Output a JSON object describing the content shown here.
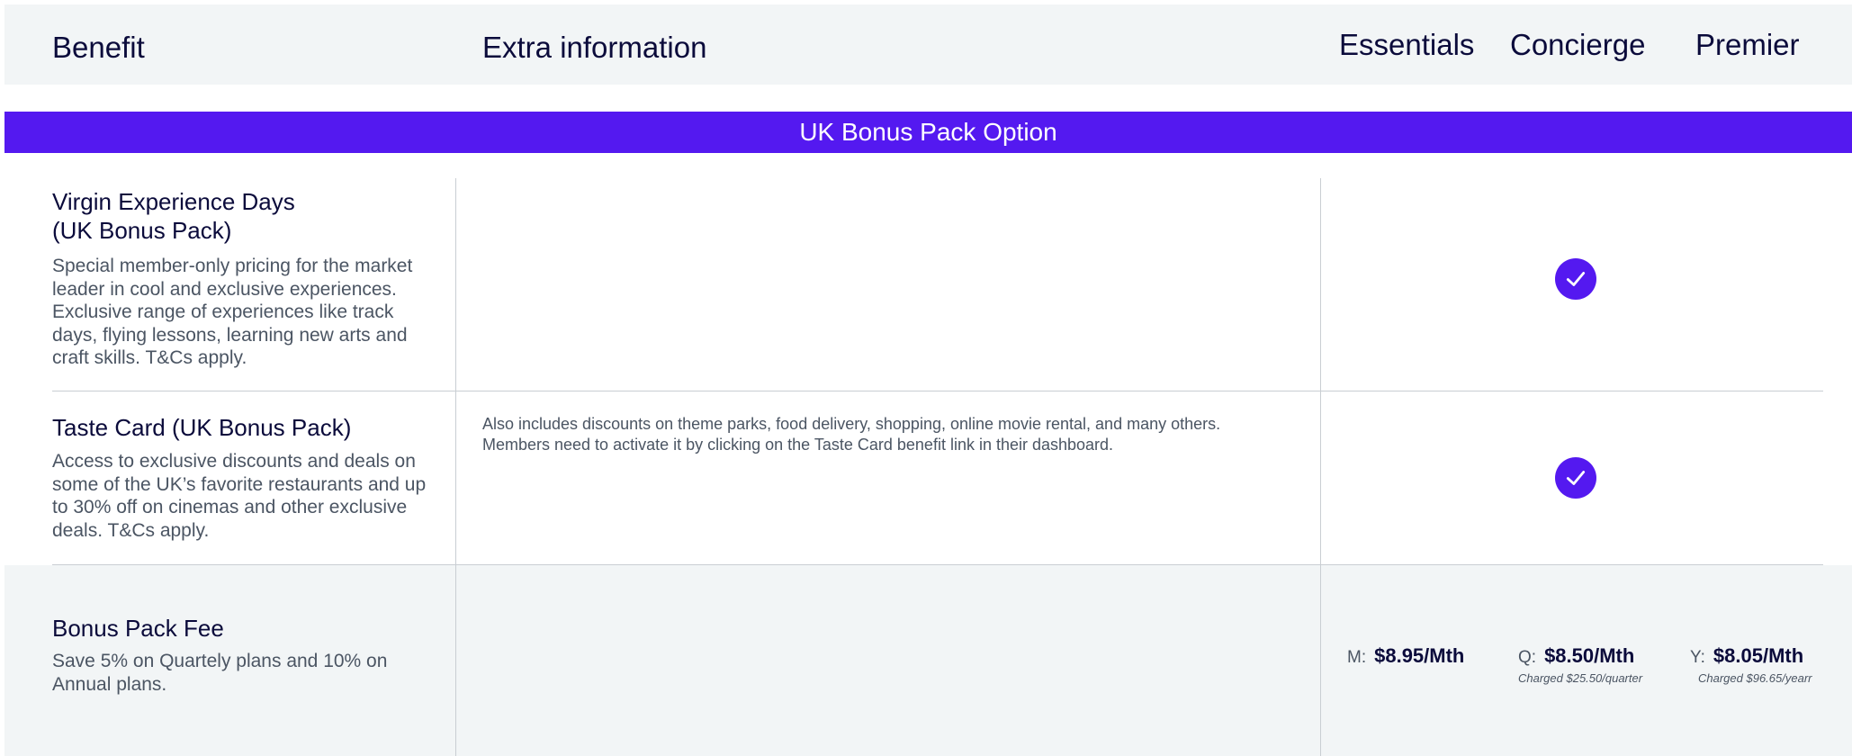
{
  "header": {
    "benefit": "Benefit",
    "extra": "Extra information",
    "essentials": "Essentials",
    "concierge": "Concierge",
    "premier": "Premier"
  },
  "section": {
    "title": "UK Bonus Pack Option"
  },
  "rows": [
    {
      "title_line1": "Virgin Experience Days",
      "title_line2": "(UK Bonus Pack)",
      "desc_lines": [
        "Special member-only pricing for the market",
        "leader in cool and exclusive experiences.",
        "Exclusive range of experiences like track",
        "days, flying lessons, learning new arts and",
        "craft skills. T&Cs apply."
      ],
      "included": {
        "essentials": false,
        "concierge": true,
        "premier": false
      }
    },
    {
      "title_line1": "Taste Card (UK Bonus Pack)",
      "desc_lines": [
        "Access to exclusive discounts and deals on",
        "some of the UK’s favorite restaurants and up",
        "to 30% off on cinemas and other exclusive",
        "deals. T&Cs apply."
      ],
      "extra_lines": [
        "Also includes discounts on theme parks, food delivery, shopping, online movie rental, and many others.",
        "Members need to activate it by clicking on the Taste Card benefit link in their dashboard."
      ],
      "included": {
        "essentials": false,
        "concierge": true,
        "premier": false
      }
    },
    {
      "title_line1": "Bonus Pack Fee",
      "desc_lines": [
        "Save 5% on Quartely plans and 10% on",
        "Annual plans."
      ],
      "prices": {
        "monthly": {
          "label": "M:",
          "value": "$8.95/Mth"
        },
        "quarterly": {
          "label": "Q:",
          "value": "$8.50/Mth",
          "note": "Charged $25.50/quarter"
        },
        "yearly": {
          "label": "Y:",
          "value": "$8.05/Mth",
          "note": "Charged $96.65/yearr"
        }
      }
    }
  ],
  "icons": {
    "check": "check-circle-icon"
  },
  "colors": {
    "accent": "#5419f0",
    "header_bg": "#f2f5f6",
    "text": "#0b0b3b"
  }
}
